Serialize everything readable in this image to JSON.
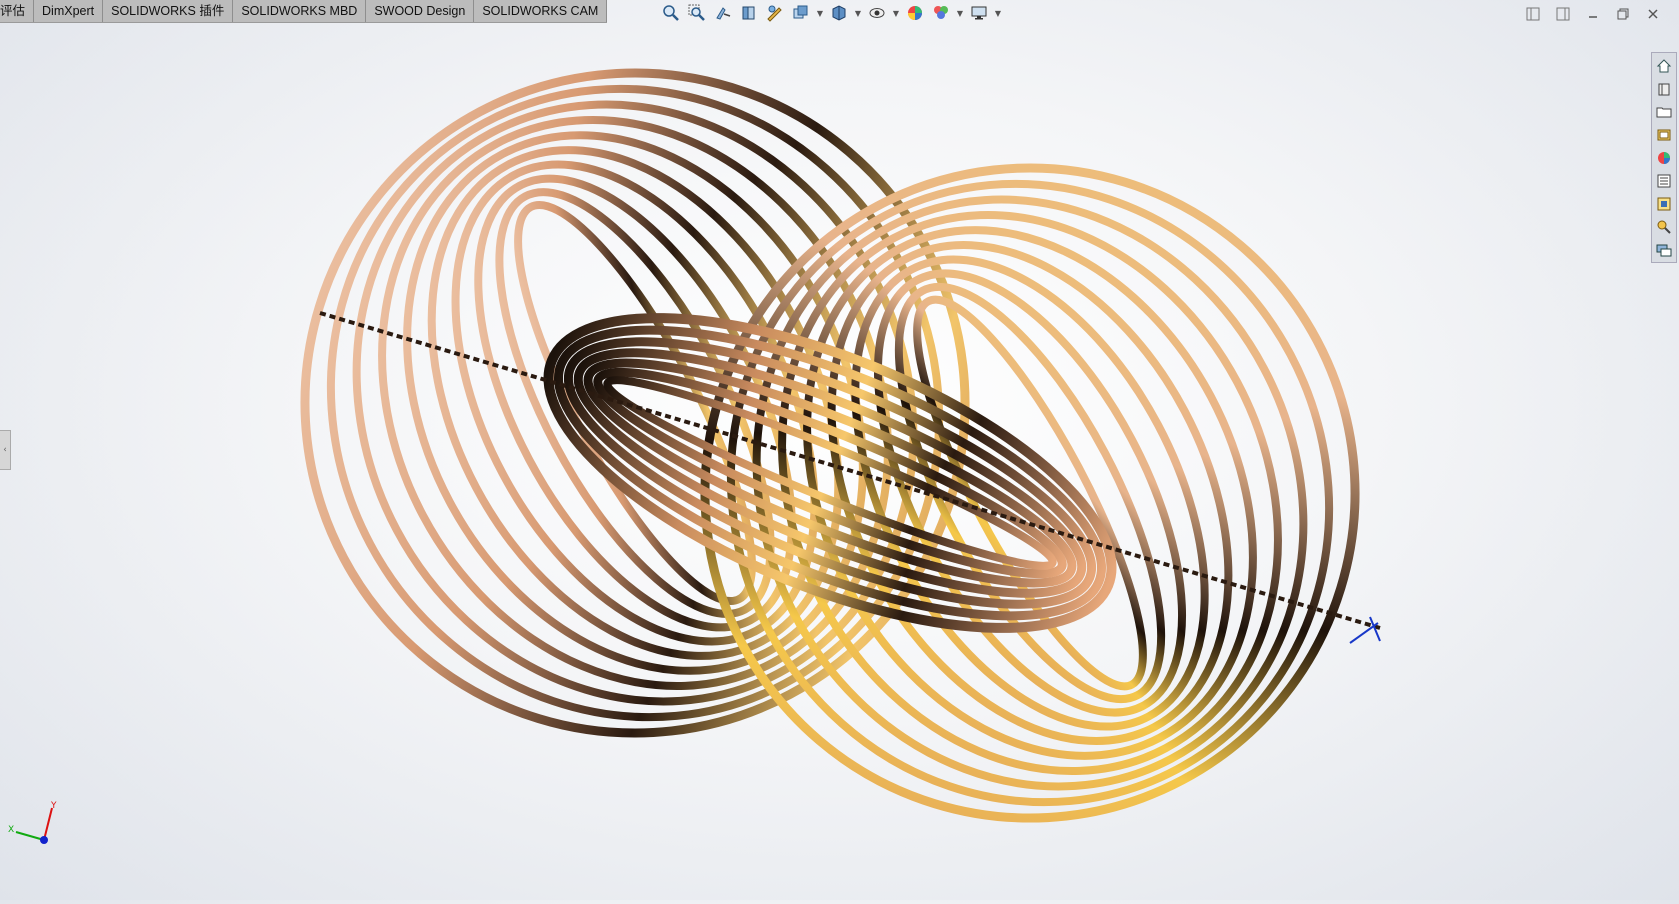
{
  "command_manager": {
    "tabs": [
      "评估",
      "DimXpert",
      "SOLIDWORKS 插件",
      "SOLIDWORKS MBD",
      "SWOOD Design",
      "SOLIDWORKS CAM"
    ]
  },
  "heads_up_toolbar": {
    "icons": [
      "zoom-to-fit-icon",
      "zoom-to-area-icon",
      "previous-view-icon",
      "section-view-icon",
      "dynamic-annotation-icon",
      "view-orientation-icon",
      "display-style-icon",
      "hide-show-icon",
      "edit-appearance-icon",
      "apply-scene-icon",
      "view-settings-icon"
    ]
  },
  "task_pane": {
    "icons": [
      "home-icon",
      "parts-library-icon",
      "file-explorer-icon",
      "view-palette-icon",
      "appearances-icon",
      "custom-properties-icon",
      "solidworks-forum-icon",
      "design-checker-icon",
      "chat-icon"
    ]
  },
  "triad": {
    "x_label": "X",
    "y_label": "Y"
  },
  "colors": {
    "copper_light": "#f0c7a4",
    "copper_mid": "#c7825a",
    "copper_dark": "#2a1a10",
    "gold_highlight": "#f5c84a",
    "axis_blue": "#1838c8"
  }
}
